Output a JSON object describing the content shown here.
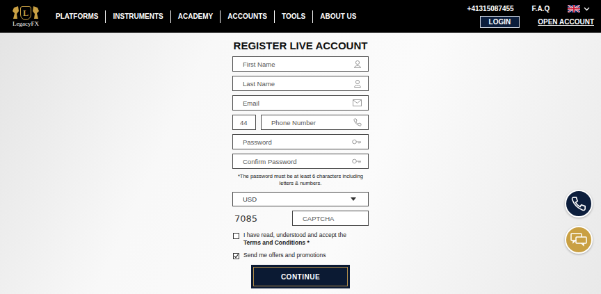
{
  "header": {
    "logo_letter": "L",
    "logo_text": "LegacyFX",
    "nav": [
      "PLATFORMS",
      "INSTRUMENTS",
      "ACADEMY",
      "ACCOUNTS",
      "TOOLS",
      "ABOUT US"
    ],
    "phone": "+41315087455",
    "faq": "F.A.Q",
    "login": "LOGIN",
    "open_account": "OPEN ACCOUNT"
  },
  "form": {
    "title": "REGISTER LIVE ACCOUNT",
    "fields": [
      {
        "kind": "person",
        "placeholder": "First Name"
      },
      {
        "kind": "person",
        "placeholder": "Last Name"
      },
      {
        "kind": "email",
        "placeholder": "Email"
      },
      {
        "kind": "phone",
        "code": "44",
        "placeholder": "Phone Number"
      },
      {
        "kind": "password",
        "placeholder": "Password"
      },
      {
        "kind": "password",
        "placeholder": "Confirm Password"
      }
    ],
    "note": "*The password must be at least 6 characters including letters & numbers.",
    "currency": "USD",
    "captcha_code": "7085",
    "captcha_placeholder": "CAPTCHA",
    "checkboxes": [
      {
        "label": "I have read, understood and accept the",
        "link": "Terms and Conditions",
        "mark": "*",
        "checked": false
      },
      {
        "label": "Send me offers and promotions",
        "link": "",
        "mark": "",
        "checked": true
      }
    ],
    "continue": "CONTINUE"
  }
}
